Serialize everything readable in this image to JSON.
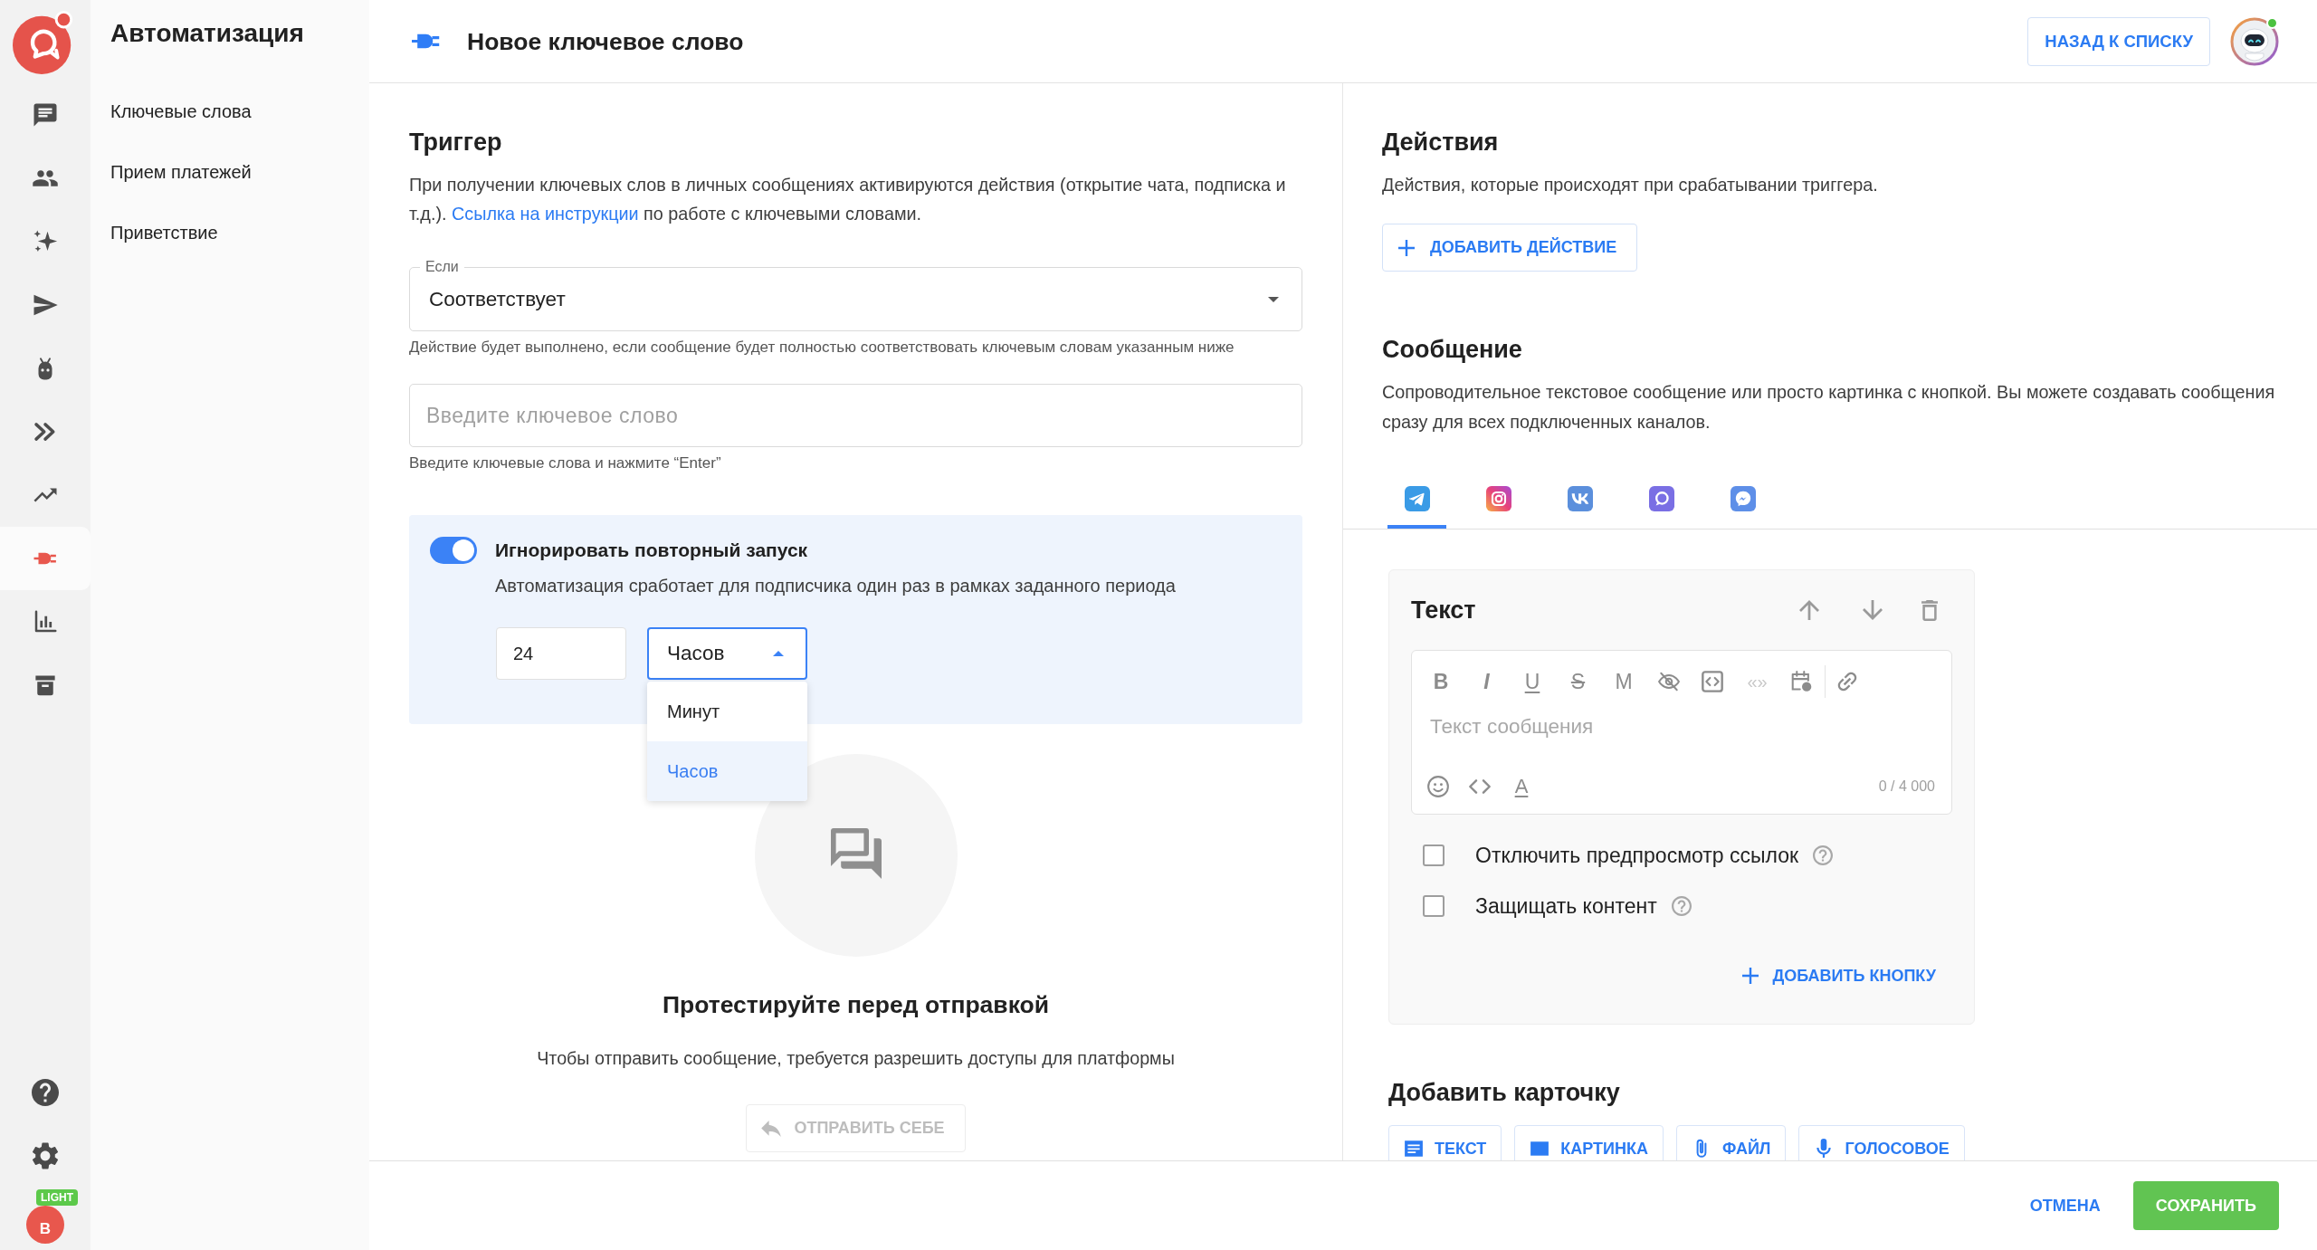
{
  "rail": {
    "items": [
      {
        "selected": false
      },
      {
        "selected": false
      },
      {
        "selected": false
      },
      {
        "selected": false
      },
      {
        "selected": false
      },
      {
        "selected": false
      },
      {
        "selected": false
      },
      {
        "selected": true
      },
      {
        "selected": false
      },
      {
        "selected": false
      }
    ],
    "account": {
      "letter": "B",
      "plan": "LIGHT"
    }
  },
  "nav": {
    "title": "Автоматизация",
    "items": [
      "Ключевые слова",
      "Прием платежей",
      "Приветствие"
    ]
  },
  "header": {
    "title": "Новое ключевое слово",
    "back_button": "НАЗАД К СПИСКУ",
    "avatar": {
      "online": true
    }
  },
  "trigger": {
    "heading": "Триггер",
    "description": {
      "before": "При получении ключевых слов в личных сообщениях активируются действия (открытие чата, подписка и т.д.). ",
      "link": "Ссылка на инструкции",
      "after": " по работе с ключевыми словами."
    },
    "condition": {
      "label": "Если",
      "value": "Соответствует",
      "helper": "Действие будет выполнено, если сообщение будет полностью соответствовать ключевым словам указанным ниже"
    },
    "keyword": {
      "placeholder": "Введите ключевое слово",
      "helper": "Введите ключевые слова и нажмите “Enter”"
    },
    "repeat": {
      "on": true,
      "title": "Игнорировать повторный запуск",
      "description": "Автоматизация сработает для подписчика один раз в рамках заданного периода",
      "amount": "24",
      "unit": {
        "value": "Часов",
        "expanded": true,
        "options": [
          {
            "label": "Минут",
            "selected": false
          },
          {
            "label": "Часов",
            "selected": true
          }
        ]
      }
    }
  },
  "test": {
    "title": "Протестируйте перед отправкой",
    "description": "Чтобы отправить сообщение, требуется разрешить доступы для платформы",
    "button": {
      "label": "ОТПРАВИТЬ СЕБЕ",
      "disabled": true
    }
  },
  "actions": {
    "heading": "Действия",
    "description": "Действия, которые происходят при срабатывании триггера.",
    "add_button": "ДОБАВИТЬ ДЕЙСТВИЕ"
  },
  "message": {
    "heading": "Сообщение",
    "description": "Сопроводительное текстовое сообщение или просто картинка с кнопкой. Вы можете создавать сообщения сразу для всех подключенных каналов.",
    "channels": [
      {
        "selected": true
      },
      {
        "selected": false
      },
      {
        "selected": false
      },
      {
        "selected": false
      },
      {
        "selected": false
      }
    ],
    "card": {
      "title": "Текст",
      "toolbar": [
        {
          "kind": "bold",
          "label": "B"
        },
        {
          "kind": "italic",
          "label": "I"
        },
        {
          "kind": "underline",
          "label": "U"
        },
        {
          "kind": "strike",
          "label": "S"
        },
        {
          "kind": "mono",
          "label": "M"
        }
      ],
      "quote": "«»",
      "placeholder": "Текст сообщения",
      "color_button": "A",
      "counter": "0 / 4 000",
      "options": [
        {
          "label": "Отключить предпросмотр ссылок",
          "checked": false
        },
        {
          "label": "Защищать контент",
          "checked": false
        }
      ],
      "add_button": "ДОБАВИТЬ КНОПКУ"
    }
  },
  "add_card": {
    "heading": "Добавить карточку",
    "buttons": [
      "ТЕКСТ",
      "КАРТИНКА",
      "ФАЙЛ",
      "ГОЛОСОВОЕ"
    ]
  },
  "footer": {
    "cancel": "ОТМЕНА",
    "save": "СОХРАНИТЬ"
  }
}
